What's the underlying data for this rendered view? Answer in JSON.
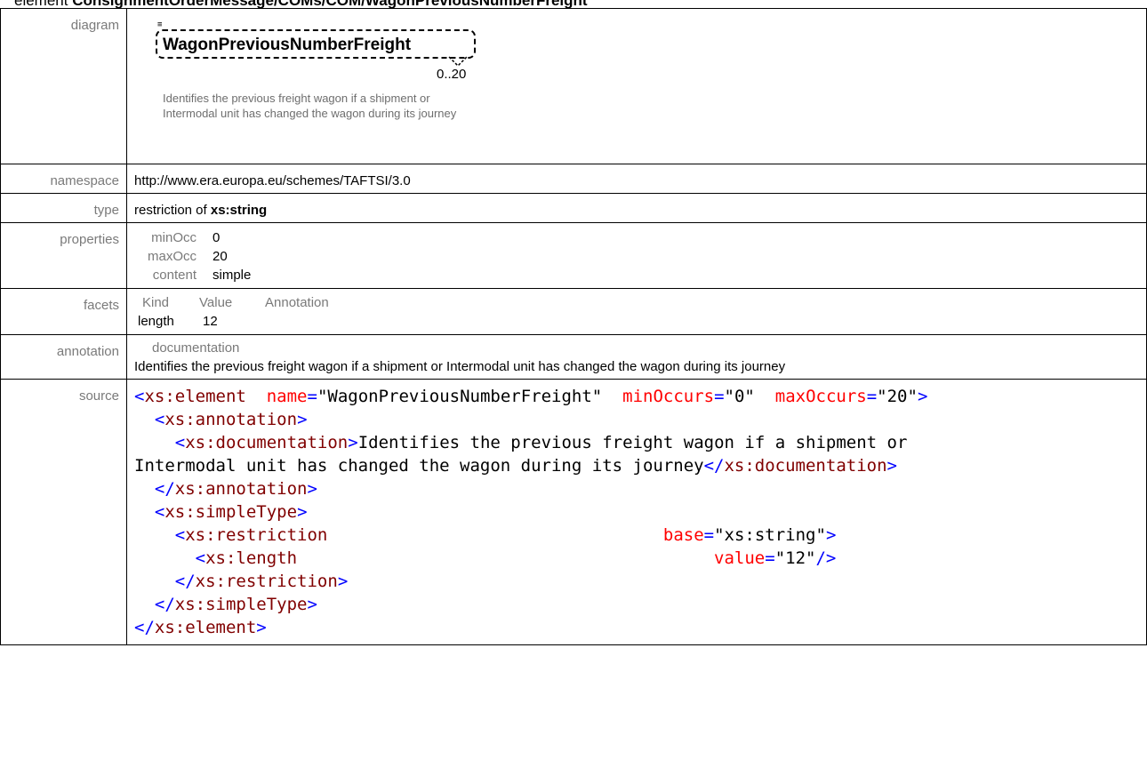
{
  "title": {
    "prefix": "element",
    "path": "ConsignmentOrderMessage/COMs/COM/WagonPreviousNumberFreight"
  },
  "labels": {
    "diagram": "diagram",
    "namespace": "namespace",
    "type": "type",
    "properties": "properties",
    "facets": "facets",
    "annotation": "annotation",
    "source": "source"
  },
  "diagram": {
    "element_name": "WagonPreviousNumberFreight",
    "occurrence": "0..20",
    "documentation": "Identifies the previous freight wagon if a shipment or Intermodal unit has changed the wagon during its journey"
  },
  "namespace": "http://www.era.europa.eu/schemes/TAFTSI/3.0",
  "type": {
    "prefix": "restriction of",
    "base": "xs:string"
  },
  "properties": [
    {
      "key": "minOcc",
      "value": "0"
    },
    {
      "key": "maxOcc",
      "value": "20"
    },
    {
      "key": "content",
      "value": "simple"
    }
  ],
  "facets": {
    "headers": [
      "Kind",
      "Value",
      "Annotation"
    ],
    "rows": [
      {
        "kind": "length",
        "value": "12",
        "annotation": ""
      }
    ]
  },
  "annotation": {
    "heading": "documentation",
    "text": "Identifies the previous freight wagon if a shipment or Intermodal unit has changed the wagon during its journey"
  },
  "source": {
    "element_open_tag": "xs:element",
    "name_attr": "name",
    "name_value": "\"WagonPreviousNumberFreight\"",
    "minOccurs_attr": "minOccurs",
    "minOccurs_value": "\"0\"",
    "maxOccurs_attr": "maxOccurs",
    "maxOccurs_value": "\"20\"",
    "annotation_tag": "xs:annotation",
    "documentation_tag": "xs:documentation",
    "doc_text_line1": "Identifies the previous freight wagon if a shipment or",
    "doc_text_line2": "Intermodal unit has changed the wagon during its journey",
    "simpleType_tag": "xs:simpleType",
    "restriction_tag": "xs:restriction",
    "base_attr": "base",
    "base_value": "\"xs:string\"",
    "length_tag": "xs:length",
    "value_attr": "value",
    "value_value": "\"12\""
  }
}
